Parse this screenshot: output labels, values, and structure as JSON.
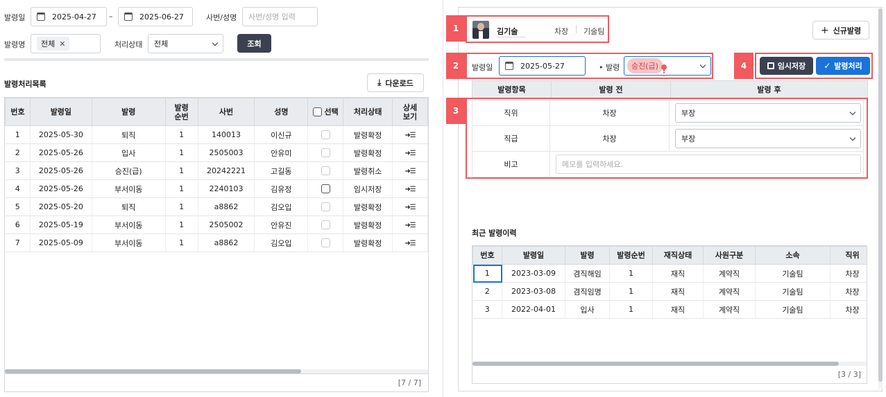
{
  "search": {
    "date_label": "발령일",
    "date_from": "2025-04-27",
    "date_sep": "–",
    "date_to": "2025-06-27",
    "emp_label": "사번/성명",
    "emp_placeholder": "사번/성명 입력",
    "order_label": "발령명",
    "order_tag": "전체",
    "status_label": "처리상태",
    "status_value": "전체",
    "search_button": "조회"
  },
  "list": {
    "title": "발령처리목록",
    "download_button": "다운로드",
    "headers": [
      "번호",
      "발령일",
      "발령",
      "발령\n순번",
      "사번",
      "성명",
      "선택",
      "처리상태",
      "상세\n보기"
    ],
    "rows": [
      {
        "no": "1",
        "date": "2025-05-30",
        "type": "퇴직",
        "seq": "1",
        "emp_no": "140013",
        "name": "이신규",
        "status": "발령확정",
        "status_color": "blue"
      },
      {
        "no": "2",
        "date": "2025-05-26",
        "type": "입사",
        "seq": "1",
        "emp_no": "2505003",
        "name": "안유미",
        "status": "발령확정",
        "status_color": "blue"
      },
      {
        "no": "3",
        "date": "2025-05-26",
        "type": "승진(급)",
        "seq": "1",
        "emp_no": "20242221",
        "name": "고길동",
        "status": "발령취소",
        "status_color": "red"
      },
      {
        "no": "4",
        "date": "2025-05-26",
        "type": "부서이동",
        "seq": "1",
        "emp_no": "2240103",
        "name": "김유정",
        "status": "임시저장",
        "status_color": "black"
      },
      {
        "no": "5",
        "date": "2025-05-20",
        "type": "퇴직",
        "seq": "1",
        "emp_no": "a8862",
        "name": "김오입",
        "status": "발령확정",
        "status_color": "blue"
      },
      {
        "no": "6",
        "date": "2025-05-19",
        "type": "부서이동",
        "seq": "1",
        "emp_no": "2505002",
        "name": "안유진",
        "status": "발령확정",
        "status_color": "blue"
      },
      {
        "no": "7",
        "date": "2025-05-09",
        "type": "부서이동",
        "seq": "1",
        "emp_no": "a8862",
        "name": "김오입",
        "status": "발령확정",
        "status_color": "blue"
      }
    ],
    "detail_glyph": "➜☰",
    "footer": "[7 / 7]"
  },
  "employee": {
    "name": "김기술",
    "position": "차장",
    "team": "기술팀"
  },
  "new_order_button": "신규발령",
  "form": {
    "date_label": "발령일",
    "date_value": "2025-05-27",
    "order_label": "• 발령",
    "order_value": "승진(급)",
    "temp_save_button": "임시저장",
    "process_button": "발령처리"
  },
  "order_table": {
    "headers": [
      "발령항목",
      "발령 전",
      "발령 후"
    ],
    "rows": [
      {
        "item": "직위",
        "before": "차장",
        "after": "부장"
      },
      {
        "item": "직급",
        "before": "차장",
        "after": "부장"
      }
    ],
    "memo_label": "비고",
    "memo_placeholder": "메모를 입력하세요."
  },
  "history": {
    "title": "최근 발령이력",
    "headers": [
      "번호",
      "발령일",
      "발령",
      "발령순번",
      "재직상태",
      "사원구분",
      "소속",
      "직위"
    ],
    "rows": [
      {
        "no": "1",
        "date": "2023-03-09",
        "type": "겸직해임",
        "seq": "1",
        "state": "재직",
        "kind": "계약직",
        "dept": "기술팀",
        "pos": "차장"
      },
      {
        "no": "2",
        "date": "2023-03-08",
        "type": "겸직임명",
        "seq": "1",
        "state": "재직",
        "kind": "계약직",
        "dept": "기술팀",
        "pos": "차장"
      },
      {
        "no": "3",
        "date": "2022-04-01",
        "type": "입사",
        "seq": "1",
        "state": "재직",
        "kind": "계약직",
        "dept": "기술팀",
        "pos": "차장"
      }
    ],
    "footer": "[3 / 3]"
  },
  "badges": [
    "1",
    "2",
    "3",
    "4"
  ],
  "colors": {
    "accent": "#1a73d9",
    "dark_button": "#3b4150",
    "callout": "#f15a5f",
    "cancel": "#e0383e"
  }
}
